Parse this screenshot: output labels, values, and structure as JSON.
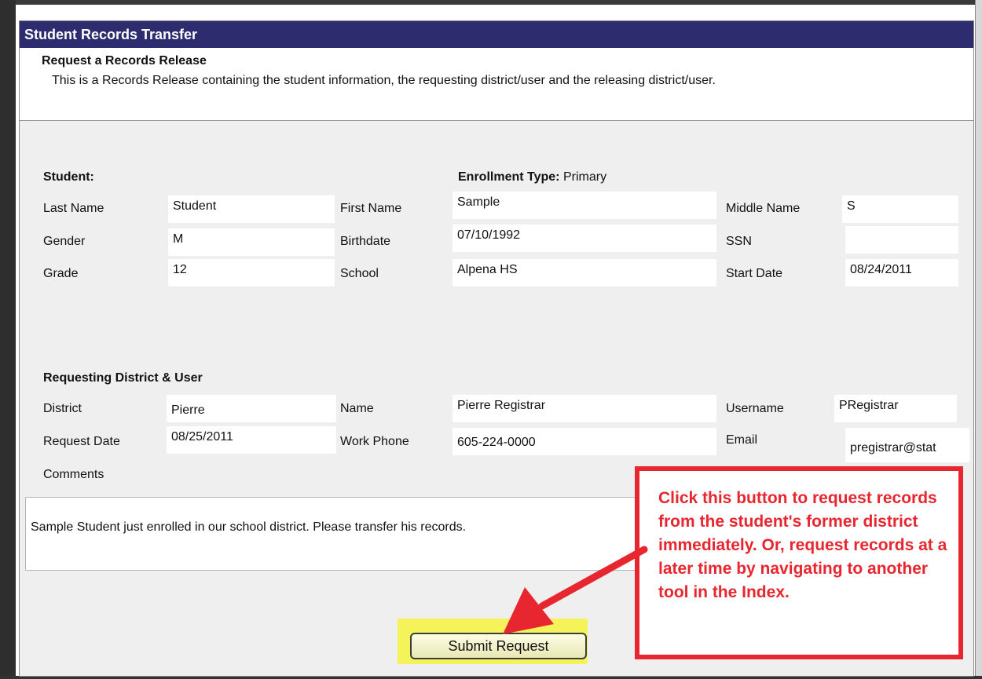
{
  "window": {
    "title": "Student Records Transfer"
  },
  "header": {
    "title": "Request a Records Release",
    "description": "This is a Records Release containing the student information, the requesting district/user and the releasing district/user."
  },
  "student": {
    "section_label": "Student:",
    "enrollment_label": "Enrollment Type:",
    "enrollment_value": "Primary",
    "last_name_label": "Last Name",
    "last_name": "Student",
    "first_name_label": "First Name",
    "first_name": "Sample",
    "middle_name_label": "Middle Name",
    "middle_name": "S",
    "gender_label": "Gender",
    "gender": "M",
    "birthdate_label": "Birthdate",
    "birthdate": "07/10/1992",
    "ssn_label": "SSN",
    "ssn": "",
    "grade_label": "Grade",
    "grade": "12",
    "school_label": "School",
    "school": "Alpena HS",
    "start_date_label": "Start Date",
    "start_date": "08/24/2011"
  },
  "requesting": {
    "section_label": "Requesting District & User",
    "district_label": "District",
    "district": "Pierre",
    "name_label": "Name",
    "name": "Pierre Registrar",
    "username_label": "Username",
    "username": "PRegistrar",
    "request_date_label": "Request Date",
    "request_date": "08/25/2011",
    "work_phone_label": "Work Phone",
    "work_phone": "605-224-0000",
    "email_label": "Email",
    "email": "pregistrar@stat"
  },
  "comments": {
    "label": "Comments",
    "text": "Sample Student just enrolled in our school district.  Please transfer his records."
  },
  "submit_label": "Submit Request",
  "callout": {
    "text": "Click this button to request records from the student's former district immediately. Or, request records at a later time by navigating to another tool in the Index."
  },
  "colors": {
    "title_bar": "#2c2c6e",
    "callout": "#e8262f",
    "highlight": "#f4f35a"
  }
}
